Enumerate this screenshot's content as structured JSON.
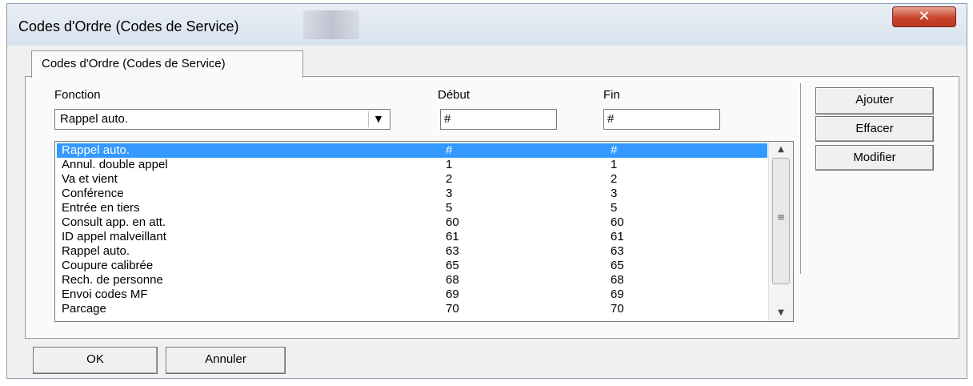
{
  "window": {
    "title": "Codes d'Ordre (Codes de Service)",
    "close_label": "✕"
  },
  "tab": {
    "label": "Codes d'Ordre (Codes de Service)"
  },
  "form": {
    "fonction_label": "Fonction",
    "debut_label": "Début",
    "fin_label": "Fin",
    "fonction_value": "Rappel auto.",
    "debut_value": "#",
    "fin_value": "#"
  },
  "list": {
    "rows": [
      {
        "name": "Rappel auto.",
        "debut": "#",
        "fin": "#"
      },
      {
        "name": "Annul. double appel",
        "debut": "1",
        "fin": "1"
      },
      {
        "name": "Va et vient",
        "debut": "2",
        "fin": "2"
      },
      {
        "name": "Conférence",
        "debut": "3",
        "fin": "3"
      },
      {
        "name": "Entrée en tiers",
        "debut": "5",
        "fin": "5"
      },
      {
        "name": "Consult app. en att.",
        "debut": "60",
        "fin": "60"
      },
      {
        "name": "ID appel malveillant",
        "debut": "61",
        "fin": "61"
      },
      {
        "name": "Rappel auto.",
        "debut": "63",
        "fin": "63"
      },
      {
        "name": "Coupure calibrée",
        "debut": "65",
        "fin": "65"
      },
      {
        "name": "Rech. de personne",
        "debut": "68",
        "fin": "68"
      },
      {
        "name": "Envoi codes MF",
        "debut": "69",
        "fin": "69"
      },
      {
        "name": "Parcage",
        "debut": "70",
        "fin": "70"
      }
    ],
    "selected_index": 0
  },
  "actions": {
    "add_label": "Ajouter",
    "delete_label": "Effacer",
    "modify_label": "Modifier"
  },
  "footer": {
    "ok_label": "OK",
    "cancel_label": "Annuler"
  },
  "icons": {
    "dropdown": "chevron-down-icon",
    "scroll_up": "arrow-up-icon",
    "scroll_down": "arrow-down-icon",
    "grip": "scroll-grip-icon"
  },
  "colors": {
    "selection": "#3399ff",
    "close_button": "#c9452b"
  }
}
